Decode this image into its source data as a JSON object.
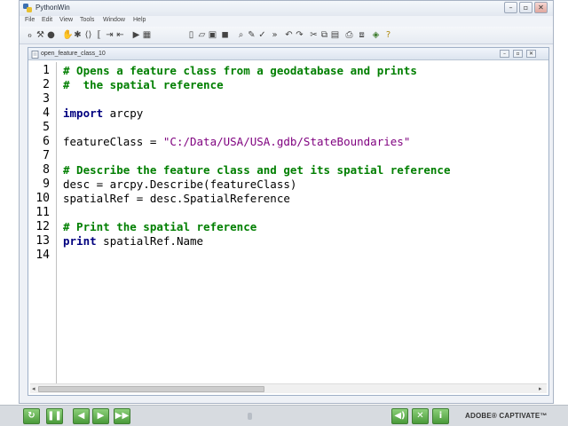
{
  "app": {
    "title": "PythonWin",
    "window_buttons": [
      "–",
      "▫",
      "✕"
    ]
  },
  "menu": [
    "File",
    "Edit",
    "View",
    "Tools",
    "Window",
    "Help"
  ],
  "toolbar_icons": [
    "glyph-icon",
    "tools-icon",
    "record-icon",
    "hand-icon",
    "bug-icon",
    "bracket-icon",
    "bracket-icon",
    "indent-icon",
    "indent-icon",
    "run-icon",
    "grid-icon",
    "new-icon",
    "open-icon",
    "save-icon",
    "save-all-icon",
    "find-icon",
    "edit-icon",
    "check-icon",
    "chevron-icon",
    "undo-icon",
    "redo-icon",
    "cut-icon",
    "copy-icon",
    "paste-icon",
    "print-icon",
    "browse-icon",
    "paint-icon",
    "help-icon"
  ],
  "editor": {
    "tab_title": "open_feature_class_10",
    "line_numbers": [
      "1",
      "2",
      "3",
      "4",
      "5",
      "6",
      "7",
      "8",
      "9",
      "10",
      "11",
      "12",
      "13",
      "14"
    ],
    "lines": [
      [
        {
          "t": "cmt",
          "v": "# Opens a feature class from a geodatabase and prints"
        }
      ],
      [
        {
          "t": "cmt",
          "v": "#  the spatial reference"
        }
      ],
      [],
      [
        {
          "t": "kw",
          "v": "import"
        },
        {
          "t": "plain",
          "v": " arcpy"
        }
      ],
      [],
      [
        {
          "t": "plain",
          "v": "featureClass = "
        },
        {
          "t": "str",
          "v": "\"C:/Data/USA/USA.gdb/StateBoundaries\""
        }
      ],
      [],
      [
        {
          "t": "cmt",
          "v": "# Describe the feature class and get its spatial reference"
        }
      ],
      [
        {
          "t": "plain",
          "v": "desc = arcpy.Describe(featureClass)"
        }
      ],
      [
        {
          "t": "plain",
          "v": "spatialRef = desc.SpatialReference"
        }
      ],
      [],
      [
        {
          "t": "cmt",
          "v": "# Print the spatial reference"
        }
      ],
      [
        {
          "t": "kw",
          "v": "print"
        },
        {
          "t": "plain",
          "v": " spatialRef.Name"
        }
      ],
      []
    ]
  },
  "playbar": {
    "brand": "ADOBE® CAPTIVATE™",
    "left_controls": [
      "rewind-icon",
      "pause-icon",
      "back-icon",
      "play-icon",
      "fast-forward-icon"
    ],
    "right_controls": [
      "audio-icon",
      "close-icon",
      "info-icon"
    ]
  },
  "colors": {
    "comment": "#007f00",
    "keyword": "#00007f",
    "string": "#7f007f",
    "playbar_button": "#5aa84a"
  }
}
